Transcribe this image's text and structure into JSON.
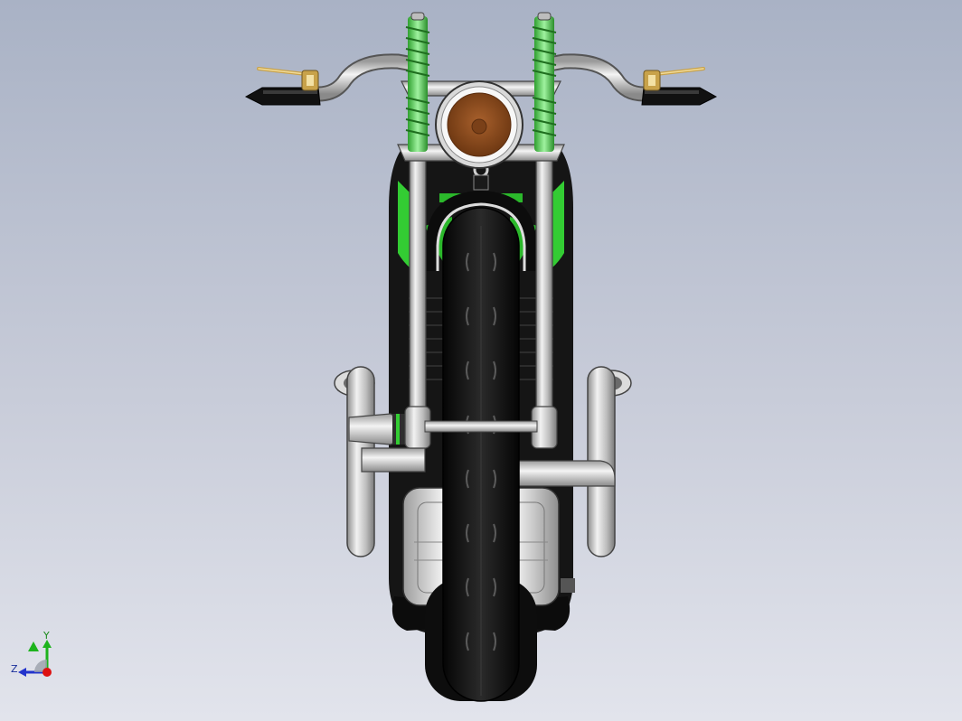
{
  "viewport": {
    "background_top": "#a9b2c5",
    "background_bottom": "#e2e4ec"
  },
  "model": {
    "part_colors": {
      "spring": "#5cd65c",
      "headlight_lens": "#8b4a1e",
      "chrome": "#c8c8c8",
      "tire": "#121212",
      "frame_body": "#1a1a1a",
      "frame_accent": "#33cc33",
      "lever": "#c8a24a"
    }
  },
  "triad": {
    "y_label": "Y",
    "z_label": "Z",
    "y_color": "#1db31d",
    "z_color": "#2233cc",
    "x_color": "#dd1111"
  }
}
